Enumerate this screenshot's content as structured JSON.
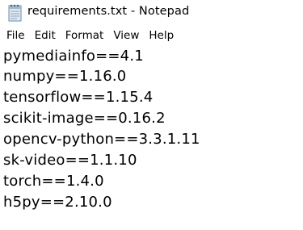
{
  "window": {
    "title": "requirements.txt - Notepad",
    "icon": "notepad-icon"
  },
  "menu": [
    {
      "label": "File"
    },
    {
      "label": "Edit"
    },
    {
      "label": "Format"
    },
    {
      "label": "View"
    },
    {
      "label": "Help"
    }
  ],
  "editor": {
    "lines": [
      "pymediainfo==4.1",
      "numpy==1.16.0",
      "tensorflow==1.15.4",
      "scikit-image==0.16.2",
      "opencv-python==3.3.1.11",
      "sk-video==1.1.10",
      "torch==1.4.0",
      "h5py==2.10.0"
    ]
  }
}
